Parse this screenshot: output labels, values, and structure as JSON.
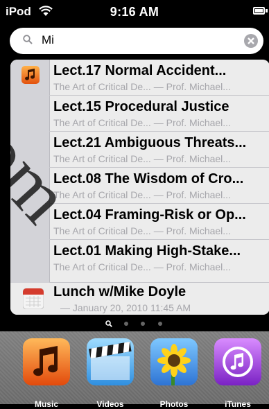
{
  "status": {
    "carrier": "iPod",
    "time": "9:16 AM"
  },
  "search": {
    "query": "Mi"
  },
  "results": [
    {
      "title": "Lect.17 Normal Accident...",
      "subtitle": "The Art of Critical De... — Prof. Michael..."
    },
    {
      "title": "Lect.15 Procedural Justice",
      "subtitle": "The Art of Critical De... — Prof. Michael..."
    },
    {
      "title": "Lect.21 Ambiguous Threats...",
      "subtitle": "The Art of Critical De... — Prof. Michael..."
    },
    {
      "title": "Lect.08 The Wisdom of Cro...",
      "subtitle": "The Art of Critical De... — Prof. Michael..."
    },
    {
      "title": "Lect.04 Framing-Risk or Op...",
      "subtitle": "The Art of Critical De... — Prof. Michael..."
    },
    {
      "title": "Lect.01 Making High-Stake...",
      "subtitle": "The Art of Critical De... — Prof. Michael..."
    }
  ],
  "calendar_result": {
    "title": "Lunch w/Mike Doyle",
    "subtitle": "— January 20, 2010 11:45 AM"
  },
  "dock": [
    {
      "label": "Music",
      "icon": "music-icon"
    },
    {
      "label": "Videos",
      "icon": "videos-icon"
    },
    {
      "label": "Photos",
      "icon": "photos-icon"
    },
    {
      "label": "iTunes",
      "icon": "itunes-icon"
    }
  ],
  "watermark": "com"
}
